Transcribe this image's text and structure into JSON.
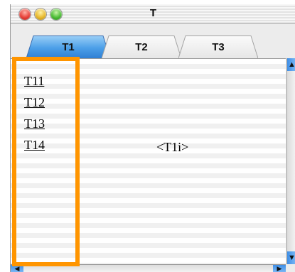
{
  "window": {
    "title": "T"
  },
  "tabs": [
    {
      "label": "T1",
      "active": true
    },
    {
      "label": "T2",
      "active": false
    },
    {
      "label": "T3",
      "active": false
    }
  ],
  "links": [
    "T11",
    "T12",
    "T13",
    "T14"
  ],
  "panel": {
    "text": "<T1i>"
  },
  "colors": {
    "highlight": "#ff9500",
    "active_tab": "#4c9fe8",
    "scroll_arrow": "#3e8ee6"
  },
  "icons": {
    "close": "close-icon",
    "minimize": "minimize-icon",
    "zoom": "zoom-icon",
    "scroll_up": "arrow-up-icon",
    "scroll_down": "arrow-down-icon",
    "scroll_left": "arrow-left-icon",
    "scroll_right": "arrow-right-icon"
  }
}
